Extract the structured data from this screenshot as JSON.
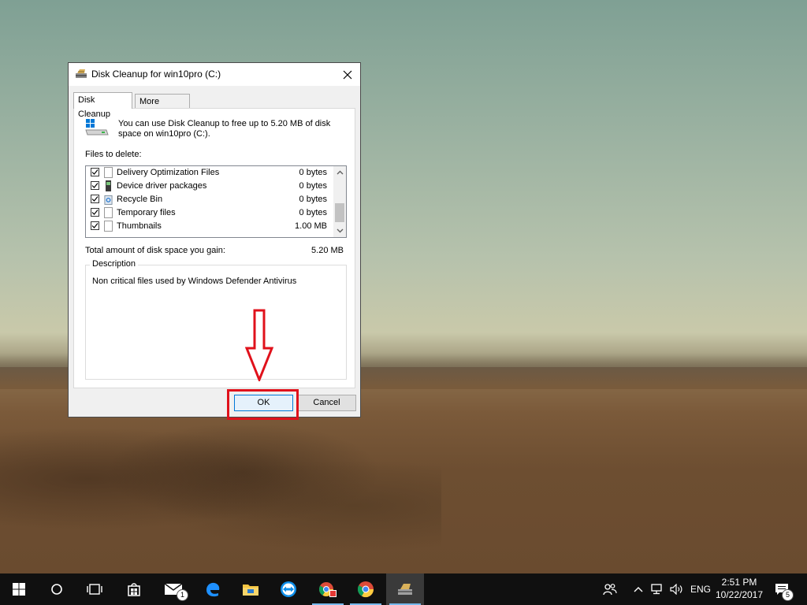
{
  "window": {
    "title": "Disk Cleanup for win10pro (C:)",
    "tabs": [
      {
        "label": "Disk Cleanup",
        "active": true
      },
      {
        "label": "More Options",
        "active": false
      }
    ],
    "info_text": "You can use Disk Cleanup to free up to 5.20 MB of disk space on win10pro (C:).",
    "files_label": "Files to delete:",
    "files": [
      {
        "name": "Delivery Optimization Files",
        "size": "0 bytes",
        "checked": true,
        "icon": "file-icon"
      },
      {
        "name": "Device driver packages",
        "size": "0 bytes",
        "checked": true,
        "icon": "driver-icon"
      },
      {
        "name": "Recycle Bin",
        "size": "0 bytes",
        "checked": true,
        "icon": "recycle-bin-icon"
      },
      {
        "name": "Temporary files",
        "size": "0 bytes",
        "checked": true,
        "icon": "file-icon"
      },
      {
        "name": "Thumbnails",
        "size": "1.00 MB",
        "checked": true,
        "icon": "file-icon"
      }
    ],
    "total_label": "Total amount of disk space you gain:",
    "total_value": "5.20 MB",
    "description_label": "Description",
    "description_text": "Non critical files used by Windows Defender Antivirus",
    "ok_label": "OK",
    "cancel_label": "Cancel"
  },
  "annotation": {
    "color": "#e0111b",
    "target": "ok-button"
  },
  "taskbar": {
    "apps": [
      {
        "name": "start-icon"
      },
      {
        "name": "search-cortana-icon"
      },
      {
        "name": "task-view-icon"
      },
      {
        "name": "store-icon"
      },
      {
        "name": "mail-icon",
        "badge": "1"
      },
      {
        "name": "edge-icon"
      },
      {
        "name": "file-explorer-icon"
      },
      {
        "name": "teamviewer-icon"
      },
      {
        "name": "chrome-remote-icon"
      },
      {
        "name": "chrome-icon"
      },
      {
        "name": "disk-cleanup-icon"
      }
    ],
    "tray": {
      "language": "ENG",
      "time": "2:51 PM",
      "date": "10/22/2017",
      "notifications_count": "5"
    }
  }
}
